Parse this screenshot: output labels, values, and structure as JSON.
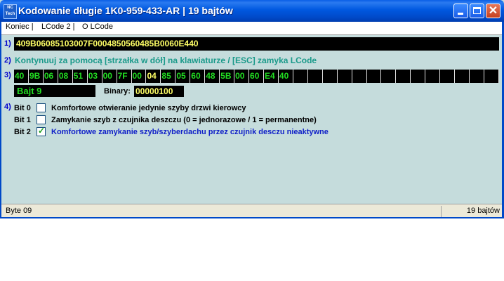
{
  "window": {
    "title": "Kodowanie długie   1K0-959-433-AR  |  19 bajtów",
    "icon_text": "NC Tech"
  },
  "menu": [
    "Koniec |",
    "LCode 2 |",
    "O LCode"
  ],
  "rows": {
    "r1": "1)",
    "r2": "2)",
    "r3": "3)",
    "r4": "4)"
  },
  "coding_string": "409B06085103007F0004850560485B0060E440",
  "instruction": "Kontynuuj za pomocą [strzałka w dół] na klawiaturze / [ESC] zamyka LCode",
  "bytes": [
    "40",
    "9B",
    "06",
    "08",
    "51",
    "03",
    "00",
    "7F",
    "00",
    "04",
    "85",
    "05",
    "60",
    "48",
    "5B",
    "00",
    "60",
    "E4",
    "40",
    "",
    "",
    "",
    "",
    "",
    "",
    "",
    "",
    "",
    "",
    "",
    "",
    "",
    ""
  ],
  "selected_byte_index": 9,
  "selected_byte_label": "Bajt 9",
  "binary_label": "Binary:",
  "binary_value": "00000100",
  "bits": [
    {
      "label": "Bit 0",
      "checked": false,
      "text": "Komfortowe otwieranie jedynie szyby drzwi kierowcy"
    },
    {
      "label": "Bit 1",
      "checked": false,
      "text": "Zamykanie szyb z czujnika deszczu (0 = jednorazowe / 1 = permanentne)"
    },
    {
      "label": "Bit 2",
      "checked": true,
      "text": "Komfortowe zamykanie szyb/szyberdachu przez czujnik desczu nieaktywne"
    }
  ],
  "status": {
    "left": "Byte 09",
    "right": "19 bajtów"
  },
  "icons": {
    "minimize": "minimize-icon",
    "maximize": "maximize-icon",
    "close": "close-icon",
    "checkmark": "checkmark-icon"
  },
  "colors": {
    "title_bar": "#0058e0",
    "background": "#c5dcdc",
    "hex_text": "#ffff66",
    "byte_text": "#22dd22",
    "instruction": "#1a9a8a",
    "active_bit": "#1020c8"
  }
}
